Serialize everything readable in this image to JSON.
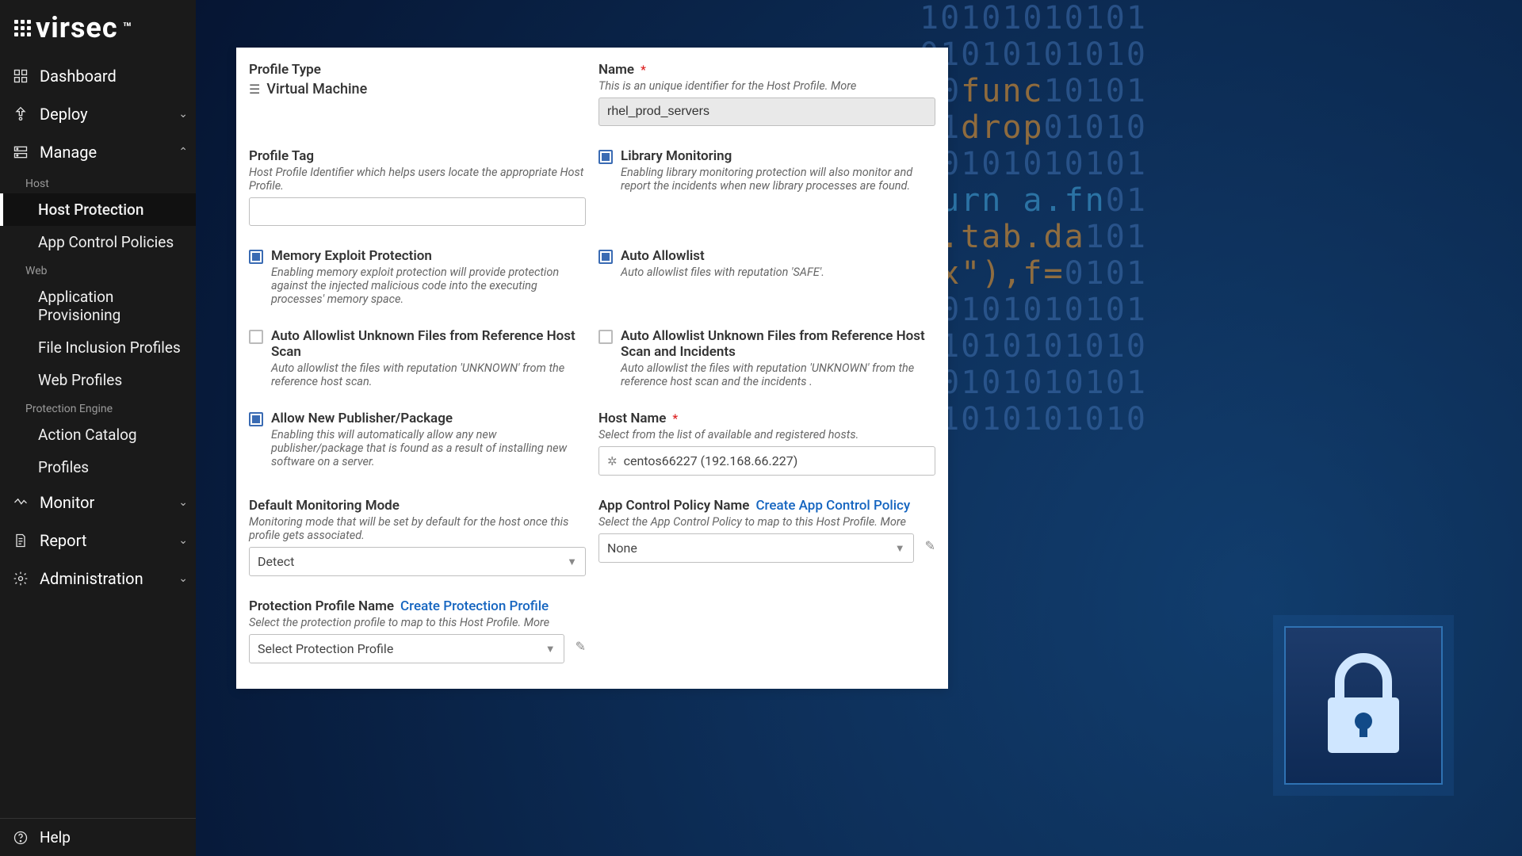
{
  "logo": "virsec",
  "nav": {
    "dashboard": "Dashboard",
    "deploy": "Deploy",
    "manage": "Manage",
    "manage_groups": {
      "host": "Host",
      "host_protection": "Host Protection",
      "app_control_policies": "App Control Policies",
      "web": "Web",
      "application_provisioning": "Application Provisioning",
      "file_inclusion_profiles": "File Inclusion Profiles",
      "web_profiles": "Web Profiles",
      "protection_engine": "Protection Engine",
      "action_catalog": "Action Catalog",
      "profiles": "Profiles"
    },
    "monitor": "Monitor",
    "report": "Report",
    "administration": "Administration",
    "help": "Help"
  },
  "form": {
    "profile_type": {
      "label": "Profile Type",
      "value": "Virtual Machine"
    },
    "name": {
      "label": "Name",
      "help": "This is an unique identifier for the Host Profile. More",
      "value": "rhel_prod_servers"
    },
    "profile_tag": {
      "label": "Profile Tag",
      "help": "Host Profile Identifier which helps users locate the appropriate Host Profile.",
      "value": ""
    },
    "library_monitoring": {
      "label": "Library Monitoring",
      "help": "Enabling library monitoring protection will also monitor and report the incidents when new library processes are found."
    },
    "mem_exploit": {
      "label": "Memory Exploit Protection",
      "help": "Enabling memory exploit protection will provide protection against the injected malicious code into the executing processes' memory space."
    },
    "auto_allowlist": {
      "label": "Auto Allowlist",
      "help": "Auto allowlist files with reputation 'SAFE'."
    },
    "auto_unknown_scan": {
      "label": "Auto Allowlist Unknown Files from Reference Host Scan",
      "help": "Auto allowlist the files with reputation 'UNKNOWN' from the reference host scan."
    },
    "auto_unknown_scan_incidents": {
      "label": "Auto Allowlist Unknown Files from Reference Host Scan and Incidents",
      "help": "Auto allowlist the files with reputation 'UNKNOWN' from the reference host scan and the incidents ."
    },
    "allow_new_pub": {
      "label": "Allow New Publisher/Package",
      "help": "Enabling this will automatically allow any new publisher/package that is found as a result of installing new software on a server."
    },
    "host_name": {
      "label": "Host Name",
      "help": "Select from the list of available and registered hosts.",
      "value": "centos66227 (192.168.66.227)"
    },
    "default_mode": {
      "label": "Default Monitoring Mode",
      "help": "Monitoring mode that will be set by default for the host once this profile gets associated.",
      "value": "Detect"
    },
    "app_control_policy": {
      "label": "App Control Policy Name",
      "link": "Create App Control Policy",
      "help": "Select the App Control Policy to map to this Host Profile. More",
      "value": "None"
    },
    "protection_profile": {
      "label": "Protection Profile Name",
      "link": "Create Protection Profile",
      "help": "Select the protection profile to map to this Host Profile. More",
      "value": "Select Protection Profile"
    }
  }
}
